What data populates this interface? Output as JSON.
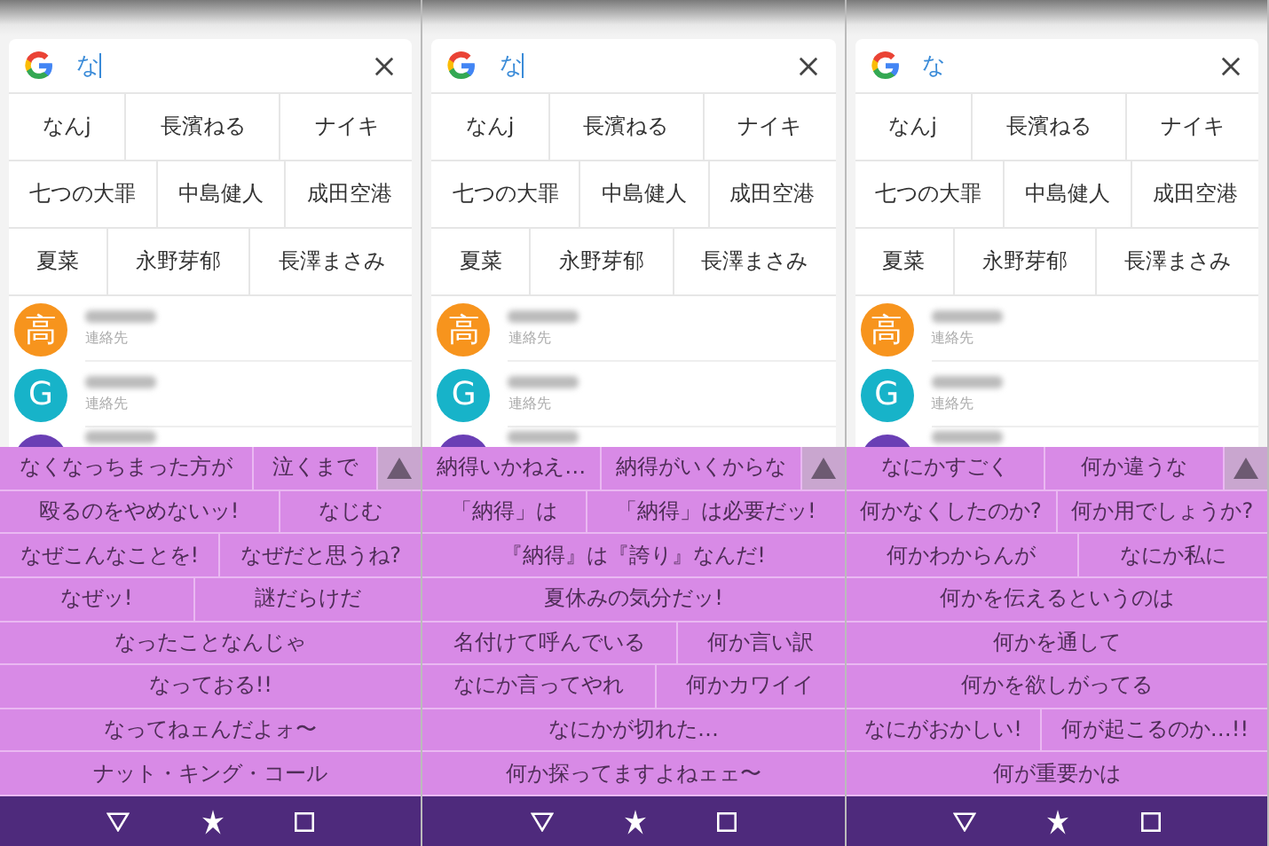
{
  "panels": [
    {
      "query": "な",
      "cursor": true,
      "suggestion_rows": [
        [
          "なんj",
          "長濱ねる",
          "ナイキ"
        ],
        [
          "七つの大罪",
          "中島健人",
          "成田空港"
        ],
        [
          "夏菜",
          "永野芽郁",
          "長澤まさみ"
        ]
      ],
      "contacts": [
        {
          "avatar": "高",
          "color": "#f7941d",
          "subtitle": "連絡先"
        },
        {
          "avatar": "G",
          "color": "#17b3c9",
          "subtitle": "連絡先"
        },
        {
          "color": "#6a3fb5"
        }
      ],
      "candidate_rows": [
        [
          "なくなっちまった方が",
          "泣くまで"
        ],
        [
          "殴るのをやめないッ!",
          "なじむ"
        ],
        [
          "なぜこんなことを!",
          "なぜだと思うね?"
        ],
        [
          "なぜッ!",
          "謎だらけだ"
        ],
        [
          "なったことなんじゃ"
        ],
        [
          "なっておる!!"
        ],
        [
          "なってねェんだよォ〜"
        ],
        [
          "ナット・キング・コール"
        ]
      ]
    },
    {
      "query": "な",
      "cursor": true,
      "suggestion_rows": [
        [
          "なんj",
          "長濱ねる",
          "ナイキ"
        ],
        [
          "七つの大罪",
          "中島健人",
          "成田空港"
        ],
        [
          "夏菜",
          "永野芽郁",
          "長澤まさみ"
        ]
      ],
      "contacts": [
        {
          "avatar": "高",
          "color": "#f7941d",
          "subtitle": "連絡先"
        },
        {
          "avatar": "G",
          "color": "#17b3c9",
          "subtitle": "連絡先"
        },
        {
          "color": "#6a3fb5"
        }
      ],
      "candidate_rows": [
        [
          "納得いかねえ…",
          "納得がいくからな"
        ],
        [
          "「納得」は",
          "「納得」は必要だッ!"
        ],
        [
          "『納得』は『誇り』なんだ!"
        ],
        [
          "夏休みの気分だッ!"
        ],
        [
          "名付けて呼んでいる",
          "何か言い訳"
        ],
        [
          "なにか言ってやれ",
          "何かカワイイ"
        ],
        [
          "なにかが切れた…"
        ],
        [
          "何か探ってますよねェェ〜"
        ]
      ]
    },
    {
      "query": "な",
      "cursor": false,
      "suggestion_rows": [
        [
          "なんj",
          "長濱ねる",
          "ナイキ"
        ],
        [
          "七つの大罪",
          "中島健人",
          "成田空港"
        ],
        [
          "夏菜",
          "永野芽郁",
          "長澤まさみ"
        ]
      ],
      "contacts": [
        {
          "avatar": "高",
          "color": "#f7941d",
          "subtitle": "連絡先"
        },
        {
          "avatar": "G",
          "color": "#17b3c9",
          "subtitle": "連絡先"
        },
        {
          "color": "#6a3fb5"
        }
      ],
      "candidate_rows": [
        [
          "なにかすごく",
          "何か違うな"
        ],
        [
          "何かなくしたのか?",
          "何か用でしょうか?"
        ],
        [
          "何かわからんが",
          "なにか私に"
        ],
        [
          "何かを伝えるというのは"
        ],
        [
          "何かを通して"
        ],
        [
          "何かを欲しがってる"
        ],
        [
          "なにがおかしい!",
          "何が起こるのか…!!"
        ],
        [
          "何が重要かは"
        ]
      ]
    }
  ]
}
